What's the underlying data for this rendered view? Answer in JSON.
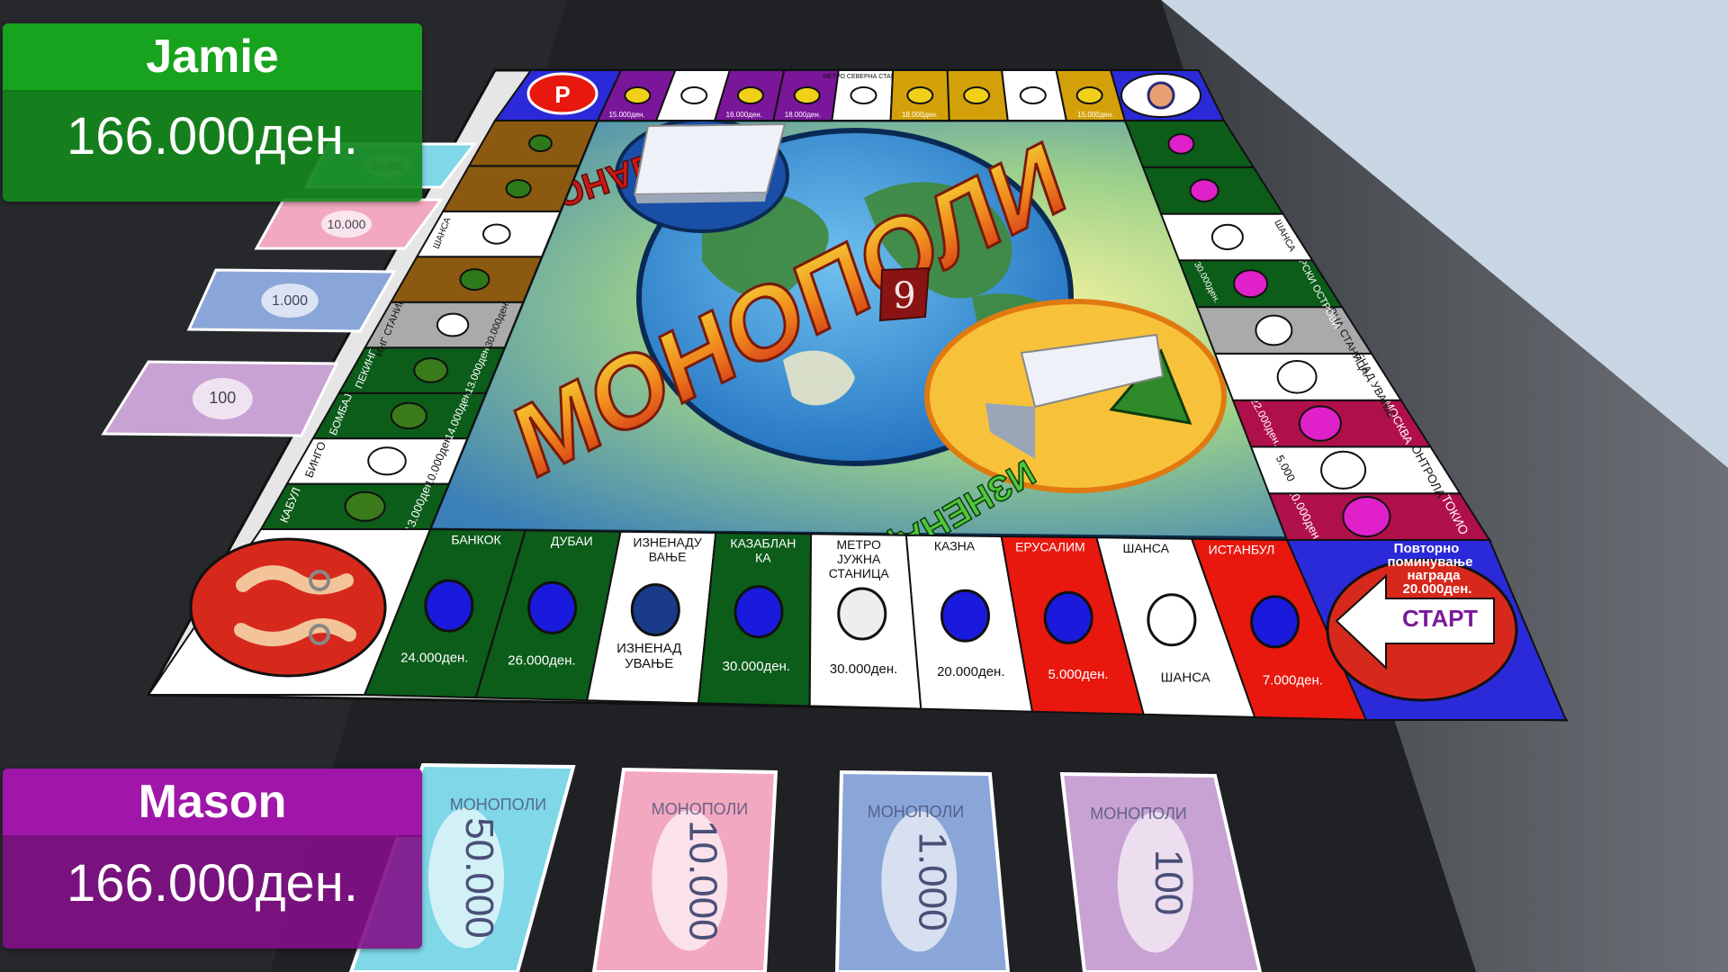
{
  "players": [
    {
      "name": "Jamie",
      "money": "166.000ден.",
      "color": "#17a31d"
    },
    {
      "name": "Mason",
      "money": "166.000ден.",
      "color": "#a016a8"
    }
  ],
  "board": {
    "title": "МОНОПОЛИ",
    "chance_deck": "ШАНСА",
    "surprise_deck": "ИЗНЕНАДУВАЊЕ",
    "dice_value": "9",
    "bottom_row": [
      {
        "name": "БАНКОК",
        "price": "24.000ден.",
        "color": "#0c5c1a",
        "kind": "property"
      },
      {
        "name": "ДУБАИ",
        "price": "26.000ден.",
        "color": "#0c5c1a",
        "kind": "property"
      },
      {
        "name": "ИЗНЕНАДУ ВАЊЕ",
        "price": "ИЗНЕНАД УВАЊЕ",
        "color": "#ffffff",
        "kind": "surprise"
      },
      {
        "name": "КАЗАБЛАН КА",
        "price": "30.000ден.",
        "color": "#0c5c1a",
        "kind": "property"
      },
      {
        "name": "МЕТРО ЈУЖНА СТАНИЦА",
        "price": "30.000ден.",
        "color": "#ffffff",
        "kind": "station"
      },
      {
        "name": "КАЗНА",
        "price": "20.000ден.",
        "color": "#ffffff",
        "kind": "property"
      },
      {
        "name": "ЕРУСАЛИМ",
        "price": "5.000ден.",
        "color": "#e8180f",
        "kind": "property"
      },
      {
        "name": "ШАНСА",
        "price": "ШАНСА",
        "color": "#ffffff",
        "kind": "chance"
      },
      {
        "name": "ИСТАНБУЛ",
        "price": "7.000ден.",
        "color": "#e8180f",
        "kind": "property"
      }
    ],
    "left_row": [
      {
        "name": "КАБУЛ",
        "price": "13.000ден.",
        "color": "#0c5c1a"
      },
      {
        "name": "БИНГО",
        "price": "10.000ден.",
        "color": "#ffffff"
      },
      {
        "name": "БОМБАЈ",
        "price": "14.000ден.",
        "color": "#0c5c1a"
      },
      {
        "name": "ПЕКИНГ",
        "price": "13.000ден.",
        "color": "#0c5c1a"
      },
      {
        "name": "ИНГ СТАНИЦА",
        "price": "30.000ден.",
        "color": "#aaaaaa"
      },
      {
        "name": "",
        "price": "",
        "color": "#8b5a10"
      },
      {
        "name": "ШАНСА",
        "price": "",
        "color": "#ffffff"
      },
      {
        "name": "",
        "price": "",
        "color": "#8b5a10"
      },
      {
        "name": "",
        "price": "",
        "color": "#8b5a10"
      }
    ],
    "right_row": [
      {
        "name": "ТОКИО",
        "price": "20.000ден.",
        "color": "#b0104a"
      },
      {
        "name": "КОНТРОЛА",
        "price": "5.000",
        "color": "#ffffff"
      },
      {
        "name": "МОСКВА",
        "price": "22.000ден.",
        "color": "#b0104a"
      },
      {
        "name": "ИЗНЕНАД УВАЊЕ",
        "price": "",
        "color": "#ffffff"
      },
      {
        "name": "СЕВЕРНА СТАНИЦА",
        "price": "",
        "color": "#aaaaaa"
      },
      {
        "name": "КАНАРСКИ ОСТРОВИ",
        "price": "30.000ден.",
        "color": "#0c5c1a"
      },
      {
        "name": "ШАНСА",
        "price": "",
        "color": "#ffffff"
      },
      {
        "name": "",
        "price": "",
        "color": "#0c5c1a"
      },
      {
        "name": "",
        "price": "",
        "color": "#0c5c1a"
      }
    ],
    "top_row": [
      {
        "name": "",
        "price": "15.000ден.",
        "color": "#7a169a"
      },
      {
        "name": "",
        "price": "",
        "color": "#ffffff"
      },
      {
        "name": "",
        "price": "16.000ден.",
        "color": "#7a169a"
      },
      {
        "name": "",
        "price": "18.000ден.",
        "color": "#7a169a"
      },
      {
        "name": "МЕТРО СЕВЕРНА СТАНИЦА",
        "price": "",
        "color": "#ffffff"
      },
      {
        "name": "",
        "price": "18.000ден.",
        "color": "#d4a00a"
      },
      {
        "name": "",
        "price": "",
        "color": "#d4a00a"
      },
      {
        "name": "",
        "price": "",
        "color": "#ffffff"
      },
      {
        "name": "",
        "price": "15.000ден.",
        "color": "#d4a00a"
      }
    ],
    "go_corner": {
      "text": "Повторно поминување награда 20.000ден.",
      "go_label": "СТАРТ"
    },
    "parking_corner": {
      "letter": "P"
    }
  },
  "banknotes": {
    "stack_values": [
      "50.000",
      "10.000",
      "1.000",
      "100"
    ],
    "player_notes": [
      "50.000",
      "10.000",
      "1.000",
      "100"
    ],
    "note_caption": "МОНОПОЛИ",
    "colors": {
      "50.000": "#7fd7e8",
      "10.000": "#f2a8c0",
      "1.000": "#8aa6d8",
      "100": "#c8a2d2"
    }
  }
}
